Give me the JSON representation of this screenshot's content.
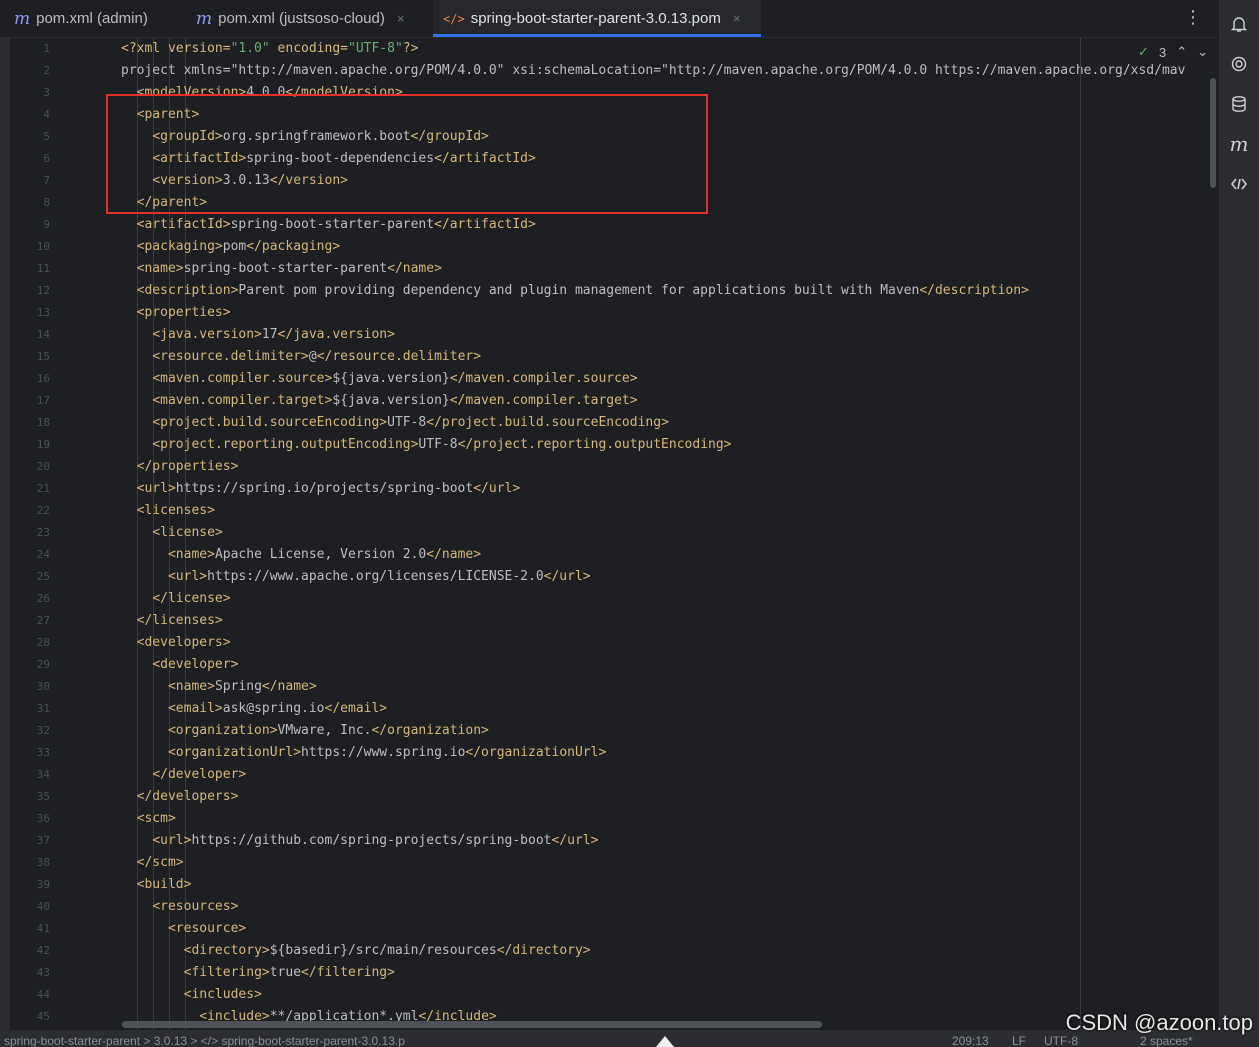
{
  "tabs": [
    {
      "icon": "m",
      "label": "pom.xml (admin)",
      "active": false,
      "close": ""
    },
    {
      "icon": "m",
      "label": "pom.xml (justsoso-cloud)",
      "active": false,
      "close": "×"
    },
    {
      "icon": "</>",
      "label": "spring-boot-starter-parent-3.0.13.pom",
      "active": true,
      "close": "×"
    }
  ],
  "tab_menu": "⋮",
  "inspection": {
    "count": "3",
    "up": "⌃",
    "down": "⌄"
  },
  "line_numbers": [
    "1",
    "2",
    "3",
    "4",
    "5",
    "6",
    "7",
    "8",
    "9",
    "10",
    "11",
    "12",
    "13",
    "14",
    "15",
    "16",
    "17",
    "18",
    "19",
    "20",
    "21",
    "22",
    "23",
    "24",
    "25",
    "26",
    "27",
    "28",
    "29",
    "30",
    "31",
    "32",
    "33",
    "34",
    "35",
    "36",
    "37",
    "38",
    "39",
    "40",
    "41",
    "42",
    "43",
    "44",
    "45"
  ],
  "code": [
    "<?xml version=\"1.0\" encoding=\"UTF-8\"?>",
    "<project xmlns=\"http://maven.apache.org/POM/4.0.0\" xsi:schemaLocation=\"http://maven.apache.org/POM/4.0.0 https://maven.apache.org/xsd/mav",
    "  <modelVersion>4.0.0</modelVersion>",
    "  <parent>",
    "    <groupId>org.springframework.boot</groupId>",
    "    <artifactId>spring-boot-dependencies</artifactId>",
    "    <version>3.0.13</version>",
    "  </parent>",
    "  <artifactId>spring-boot-starter-parent</artifactId>",
    "  <packaging>pom</packaging>",
    "  <name>spring-boot-starter-parent</name>",
    "  <description>Parent pom providing dependency and plugin management for applications built with Maven</description>",
    "  <properties>",
    "    <java.version>17</java.version>",
    "    <resource.delimiter>@</resource.delimiter>",
    "    <maven.compiler.source>${java.version}</maven.compiler.source>",
    "    <maven.compiler.target>${java.version}</maven.compiler.target>",
    "    <project.build.sourceEncoding>UTF-8</project.build.sourceEncoding>",
    "    <project.reporting.outputEncoding>UTF-8</project.reporting.outputEncoding>",
    "  </properties>",
    "  <url>https://spring.io/projects/spring-boot</url>",
    "  <licenses>",
    "    <license>",
    "      <name>Apache License, Version 2.0</name>",
    "      <url>https://www.apache.org/licenses/LICENSE-2.0</url>",
    "    </license>",
    "  </licenses>",
    "  <developers>",
    "    <developer>",
    "      <name>Spring</name>",
    "      <email>ask@spring.io</email>",
    "      <organization>VMware, Inc.</organization>",
    "      <organizationUrl>https://www.spring.io</organizationUrl>",
    "    </developer>",
    "  </developers>",
    "  <scm>",
    "    <url>https://github.com/spring-projects/spring-boot</url>",
    "  </scm>",
    "  <build>",
    "    <resources>",
    "      <resource>",
    "        <directory>${basedir}/src/main/resources</directory>",
    "        <filtering>true</filtering>",
    "        <includes>",
    "          <include>**/application*.yml</include>"
  ],
  "statusbar": {
    "breadcrumb": "spring-boot-starter-parent  >  3.0.13  >  </> spring-boot-starter-parent-3.0.13.p",
    "position": "209:13",
    "line_sep": "LF",
    "encoding": "UTF-8",
    "indent": "2 spaces*"
  },
  "watermark": "CSDN @azoon.top"
}
